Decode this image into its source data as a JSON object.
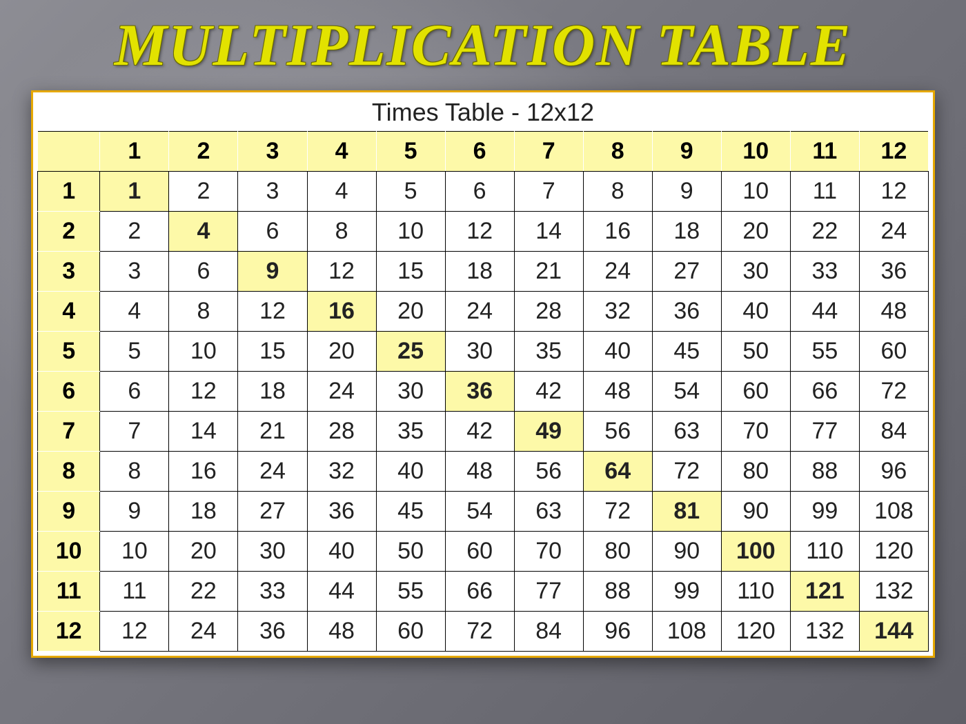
{
  "title": "MULTIPLICATION TABLE",
  "subtitle": "Times Table - 12x12",
  "chart_data": {
    "type": "table",
    "title": "Times Table - 12x12",
    "col_headers": [
      "1",
      "2",
      "3",
      "4",
      "5",
      "6",
      "7",
      "8",
      "9",
      "10",
      "11",
      "12"
    ],
    "row_headers": [
      "1",
      "2",
      "3",
      "4",
      "5",
      "6",
      "7",
      "8",
      "9",
      "10",
      "11",
      "12"
    ],
    "values": [
      [
        1,
        2,
        3,
        4,
        5,
        6,
        7,
        8,
        9,
        10,
        11,
        12
      ],
      [
        2,
        4,
        6,
        8,
        10,
        12,
        14,
        16,
        18,
        20,
        22,
        24
      ],
      [
        3,
        6,
        9,
        12,
        15,
        18,
        21,
        24,
        27,
        30,
        33,
        36
      ],
      [
        4,
        8,
        12,
        16,
        20,
        24,
        28,
        32,
        36,
        40,
        44,
        48
      ],
      [
        5,
        10,
        15,
        20,
        25,
        30,
        35,
        40,
        45,
        50,
        55,
        60
      ],
      [
        6,
        12,
        18,
        24,
        30,
        36,
        42,
        48,
        54,
        60,
        66,
        72
      ],
      [
        7,
        14,
        21,
        28,
        35,
        42,
        49,
        56,
        63,
        70,
        77,
        84
      ],
      [
        8,
        16,
        24,
        32,
        40,
        48,
        56,
        64,
        72,
        80,
        88,
        96
      ],
      [
        9,
        18,
        27,
        36,
        45,
        54,
        63,
        72,
        81,
        90,
        99,
        108
      ],
      [
        10,
        20,
        30,
        40,
        50,
        60,
        70,
        80,
        90,
        100,
        110,
        120
      ],
      [
        11,
        22,
        33,
        44,
        55,
        66,
        77,
        88,
        99,
        110,
        121,
        132
      ],
      [
        12,
        24,
        36,
        48,
        60,
        72,
        84,
        96,
        108,
        120,
        132,
        144
      ]
    ],
    "highlight": "diagonal"
  }
}
